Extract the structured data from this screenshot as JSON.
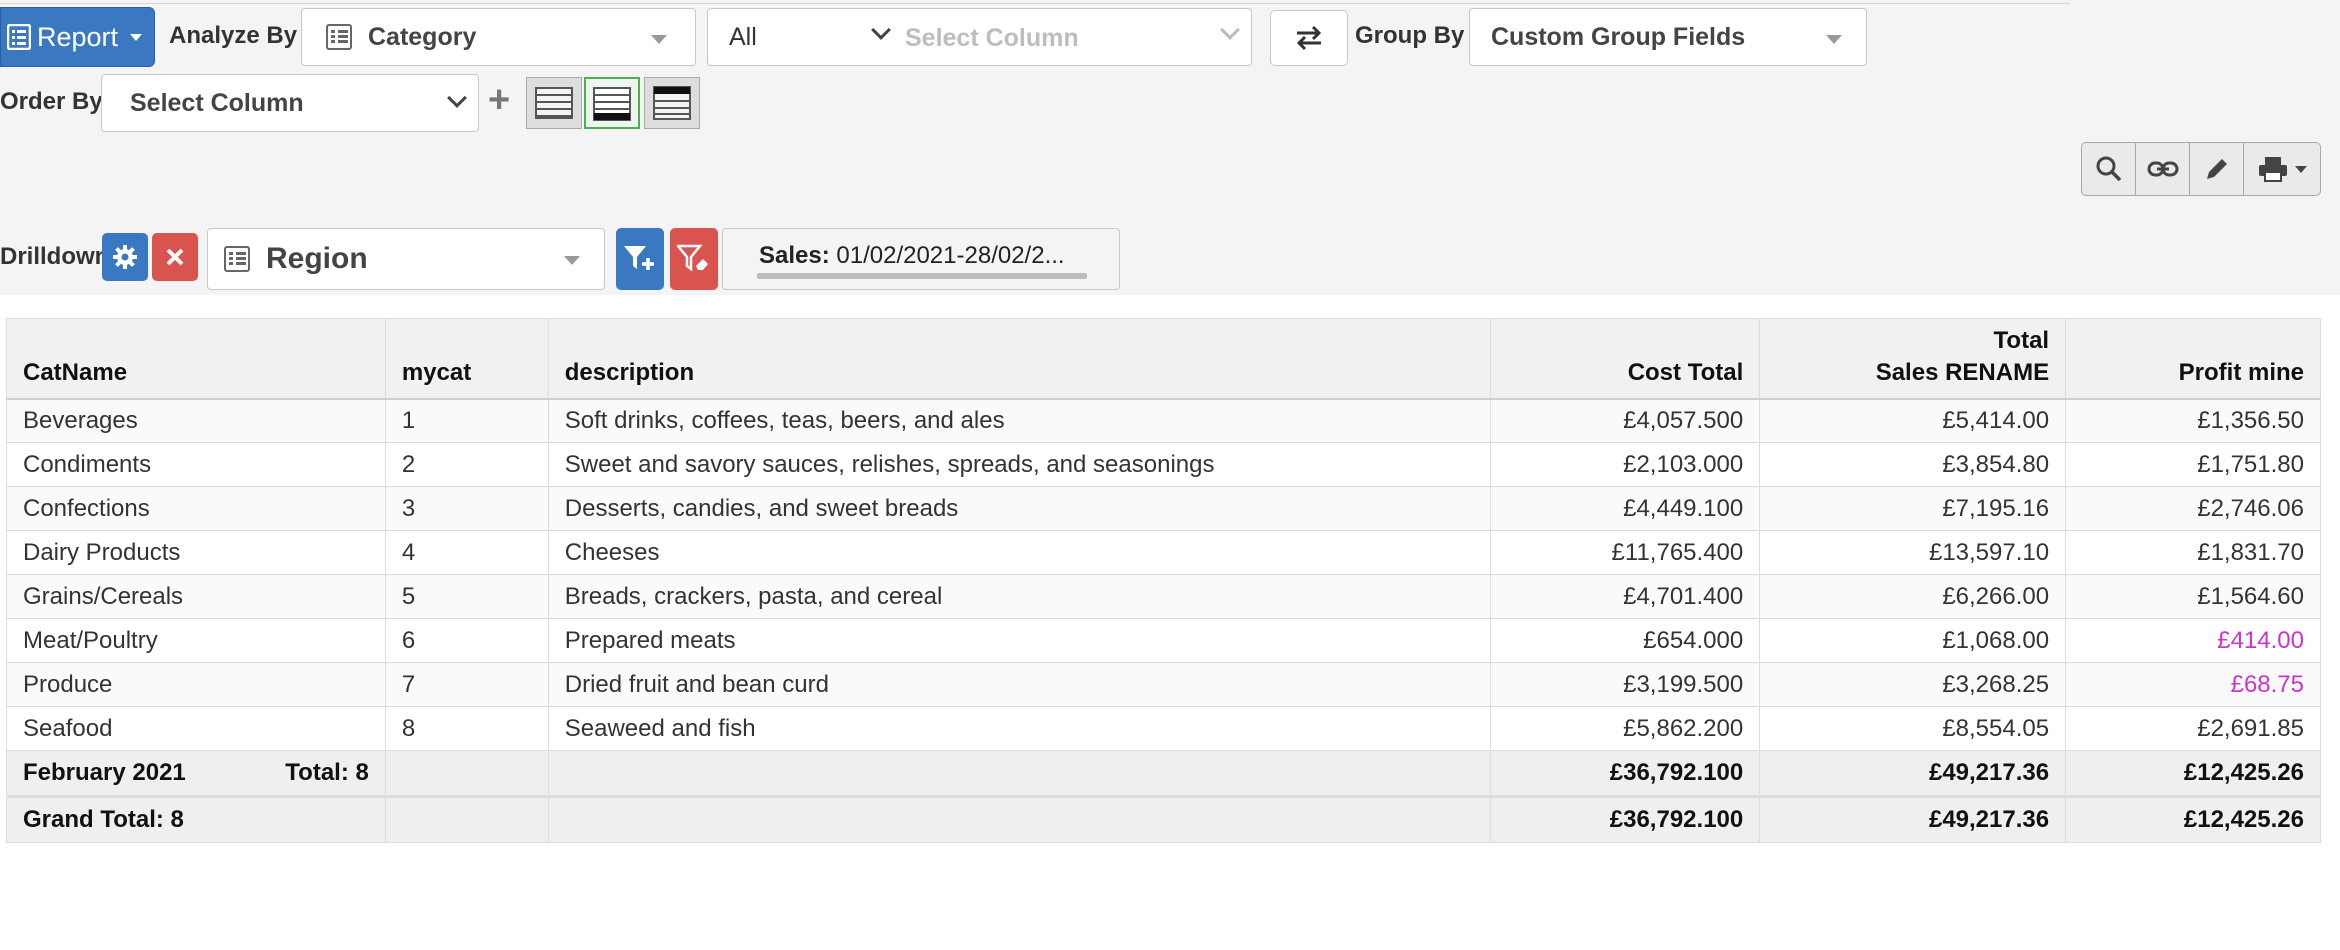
{
  "toolbar": {
    "report_label": "Report",
    "analyze_by_label": "Analyze By",
    "analyze_by_value": "Category",
    "scope_value": "All",
    "column_placeholder": "Select Column",
    "group_by_label": "Group By",
    "group_by_value": "Custom Group Fields",
    "order_by_label": "Order By",
    "order_by_value": "Select Column",
    "plus_label": "+"
  },
  "drilldown": {
    "label": "Drilldown",
    "field_value": "Region",
    "filter_key": "Sales:",
    "filter_value": " 01/02/2021-28/02/2..."
  },
  "table": {
    "headers": {
      "catname": "CatName",
      "mycat": "mycat",
      "description": "description",
      "cost_total": "Cost Total",
      "total_sales_line1": "Total",
      "total_sales_line2": "Sales RENAME",
      "profit": "Profit mine"
    },
    "rows": [
      {
        "catname": "Beverages",
        "mycat": "1",
        "description": "Soft drinks, coffees, teas, beers, and ales",
        "cost": "£4,057.500",
        "sales": "£5,414.00",
        "profit": "£1,356.50"
      },
      {
        "catname": "Condiments",
        "mycat": "2",
        "description": "Sweet and savory sauces, relishes, spreads, and seasonings",
        "cost": "£2,103.000",
        "sales": "£3,854.80",
        "profit": "£1,751.80"
      },
      {
        "catname": "Confections",
        "mycat": "3",
        "description": "Desserts, candies, and sweet breads",
        "cost": "£4,449.100",
        "sales": "£7,195.16",
        "profit": "£2,746.06"
      },
      {
        "catname": "Dairy Products",
        "mycat": "4",
        "description": "Cheeses",
        "cost": "£11,765.400",
        "sales": "£13,597.10",
        "profit": "£1,831.70"
      },
      {
        "catname": "Grains/Cereals",
        "mycat": "5",
        "description": "Breads, crackers, pasta, and cereal",
        "cost": "£4,701.400",
        "sales": "£6,266.00",
        "profit": "£1,564.60"
      },
      {
        "catname": "Meat/Poultry",
        "mycat": "6",
        "description": "Prepared meats",
        "cost": "£654.000",
        "sales": "£1,068.00",
        "profit": "£414.00"
      },
      {
        "catname": "Produce",
        "mycat": "7",
        "description": "Dried fruit and bean curd",
        "cost": "£3,199.500",
        "sales": "£3,268.25",
        "profit": "£68.75"
      },
      {
        "catname": "Seafood",
        "mycat": "8",
        "description": "Seaweed and fish",
        "cost": "£5,862.200",
        "sales": "£8,554.05",
        "profit": "£2,691.85"
      }
    ],
    "subtotal": {
      "group": "February 2021",
      "count_label": "Total: 8",
      "cost": "£36,792.100",
      "sales": "£49,217.36",
      "profit": "£12,425.26"
    },
    "grand_total": {
      "label": "Grand Total: 8",
      "cost": "£36,792.100",
      "sales": "£49,217.36",
      "profit": "£12,425.26"
    }
  },
  "colors": {
    "primary": "#3a78c2",
    "danger": "#d9534f",
    "low_profit": "#cc33cc"
  }
}
